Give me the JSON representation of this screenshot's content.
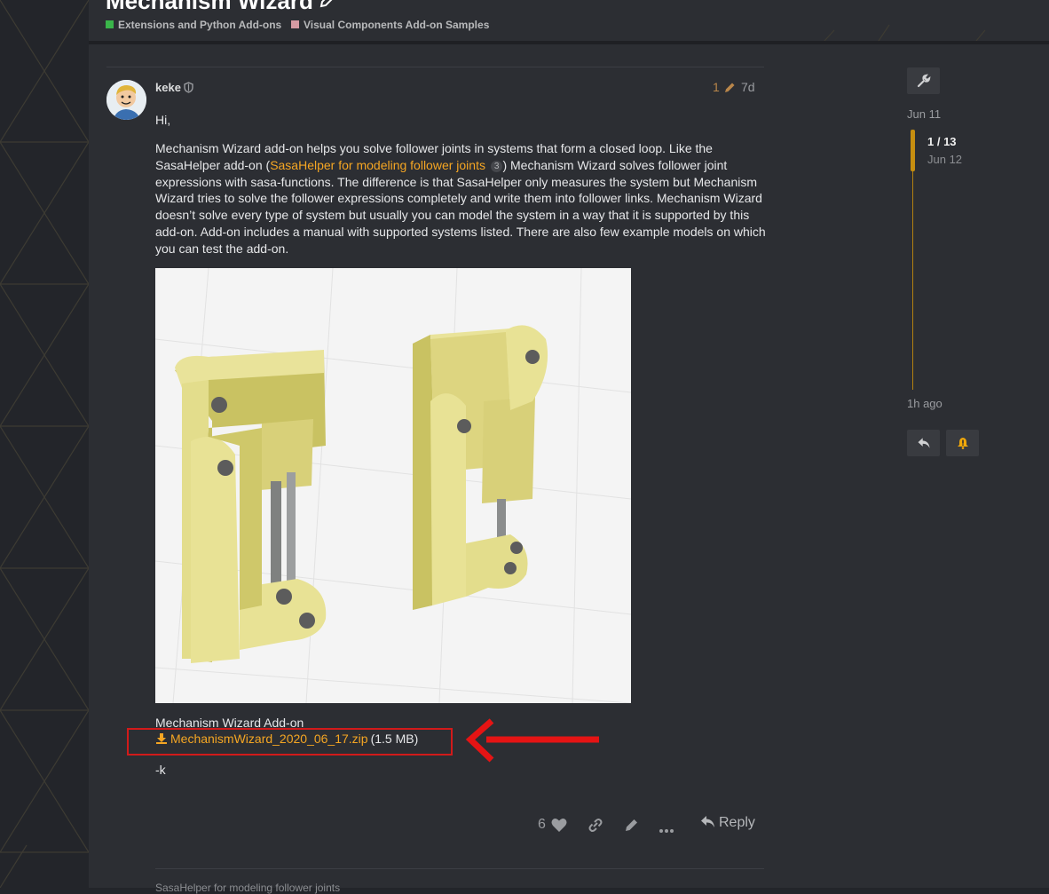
{
  "topic": {
    "title": "Mechanism Wizard",
    "categories": [
      {
        "label": "Extensions and Python Add-ons",
        "color": "#3ab54a"
      },
      {
        "label": "Visual Components Add-on Samples",
        "color": "#d59aa3"
      }
    ]
  },
  "post": {
    "author": "keke",
    "edit_count": "1",
    "date": "7d",
    "greeting": "Hi,",
    "body_part1": "Mechanism Wizard add-on helps you solve follower joints in systems that form a closed loop. Like the SasaHelper add-on (",
    "link_text": "SasaHelper for modeling follower joints",
    "link_clicks": "3",
    "body_part2": ") Mechanism Wizard solves follower joint expressions with sasa-functions. The difference is that SasaHelper only measures the system but Mechanism Wizard tries to solve the follower expressions completely and write them into follower links. Mechanism Wizard doesn’t solve every type of system but usually you can model the system in a way that it is supported by this add-on. Add-on includes a manual with supported systems listed. There are also few example models on which you can test the add-on.",
    "addon_title": "Mechanism Wizard Add-on",
    "attachment_name": "MechanismWizard_2020_06_17.zip",
    "attachment_size": "(1.5 MB)",
    "signoff": "-k",
    "like_count": "6",
    "reply_label": "Reply",
    "next_link_partial": "SasaHelper for modeling follower joints"
  },
  "timeline": {
    "start_date": "Jun 11",
    "position": "1 / 13",
    "position_date": "Jun 12",
    "end_label": "1h ago"
  },
  "colors": {
    "accent": "#f5a623",
    "timeline": "#c68e10",
    "highlight": "#d21a1a",
    "background": "#2c2e33"
  }
}
